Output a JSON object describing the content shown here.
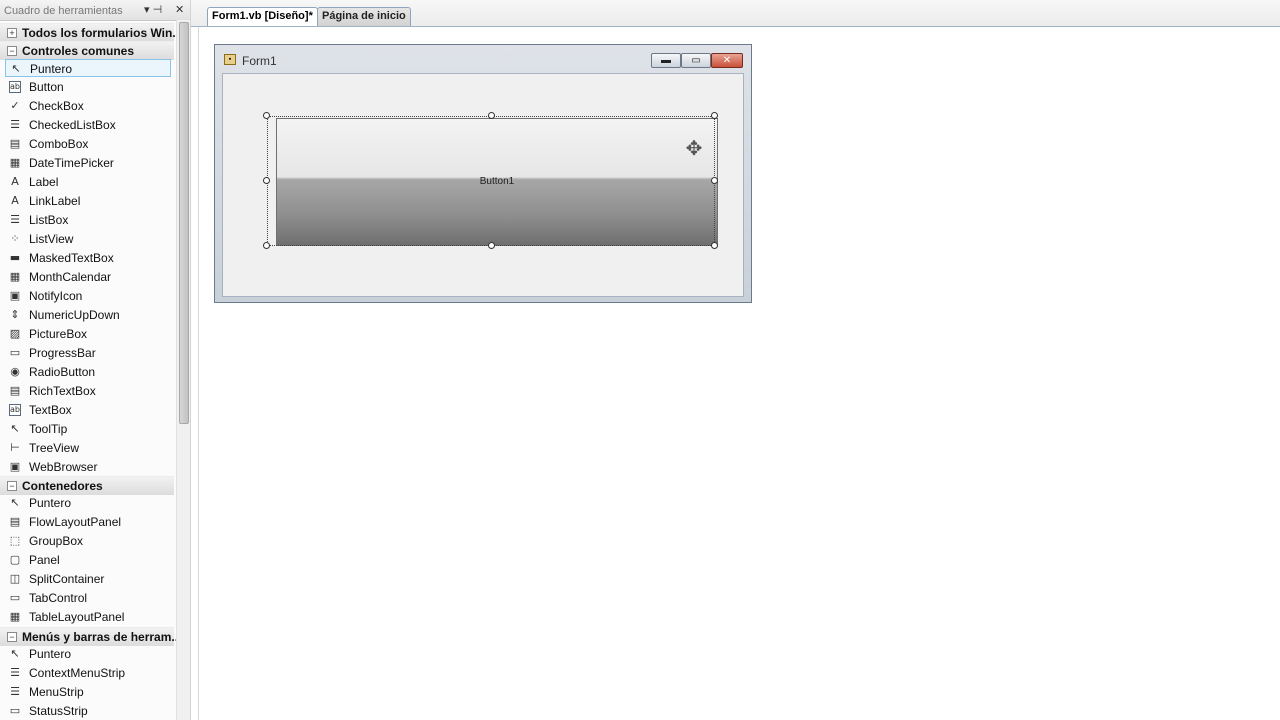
{
  "toolbox": {
    "title": "Cuadro de herramientas",
    "pin_icon": "▾ ⊣",
    "close_icon": "✕",
    "groups": {
      "all": {
        "expander": "+",
        "label": "Todos los formularios Win..."
      },
      "common": {
        "expander": "−",
        "label": "Controles comunes"
      },
      "containers": {
        "expander": "−",
        "label": "Contenedores"
      },
      "menus": {
        "expander": "−",
        "label": "Menús y barras de herram..."
      }
    },
    "common_items": [
      {
        "label": "Puntero",
        "icon": "pointer-icon",
        "glyph": "↖"
      },
      {
        "label": "Button",
        "icon": "button-icon",
        "glyph": "ab"
      },
      {
        "label": "CheckBox",
        "icon": "checkbox-icon",
        "glyph": "✓"
      },
      {
        "label": "CheckedListBox",
        "icon": "checkedlistbox-icon",
        "glyph": "☰"
      },
      {
        "label": "ComboBox",
        "icon": "combobox-icon",
        "glyph": "▤"
      },
      {
        "label": "DateTimePicker",
        "icon": "datetimepicker-icon",
        "glyph": "▦"
      },
      {
        "label": "Label",
        "icon": "label-icon",
        "glyph": "A"
      },
      {
        "label": "LinkLabel",
        "icon": "linklabel-icon",
        "glyph": "A"
      },
      {
        "label": "ListBox",
        "icon": "listbox-icon",
        "glyph": "☰"
      },
      {
        "label": "ListView",
        "icon": "listview-icon",
        "glyph": "⁘"
      },
      {
        "label": "MaskedTextBox",
        "icon": "maskedtextbox-icon",
        "glyph": "▬"
      },
      {
        "label": "MonthCalendar",
        "icon": "monthcalendar-icon",
        "glyph": "▦"
      },
      {
        "label": "NotifyIcon",
        "icon": "notifyicon-icon",
        "glyph": "▣"
      },
      {
        "label": "NumericUpDown",
        "icon": "numericupdown-icon",
        "glyph": "⇕"
      },
      {
        "label": "PictureBox",
        "icon": "picturebox-icon",
        "glyph": "▨"
      },
      {
        "label": "ProgressBar",
        "icon": "progressbar-icon",
        "glyph": "▭"
      },
      {
        "label": "RadioButton",
        "icon": "radiobutton-icon",
        "glyph": "◉"
      },
      {
        "label": "RichTextBox",
        "icon": "richtextbox-icon",
        "glyph": "▤"
      },
      {
        "label": "TextBox",
        "icon": "textbox-icon",
        "glyph": "ab"
      },
      {
        "label": "ToolTip",
        "icon": "tooltip-icon",
        "glyph": "↖"
      },
      {
        "label": "TreeView",
        "icon": "treeview-icon",
        "glyph": "⊢"
      },
      {
        "label": "WebBrowser",
        "icon": "webbrowser-icon",
        "glyph": "▣"
      }
    ],
    "container_items": [
      {
        "label": "Puntero",
        "icon": "pointer-icon",
        "glyph": "↖"
      },
      {
        "label": "FlowLayoutPanel",
        "icon": "flowlayoutpanel-icon",
        "glyph": "▤"
      },
      {
        "label": "GroupBox",
        "icon": "groupbox-icon",
        "glyph": "⬚"
      },
      {
        "label": "Panel",
        "icon": "panel-icon",
        "glyph": "▢"
      },
      {
        "label": "SplitContainer",
        "icon": "splitcontainer-icon",
        "glyph": "◫"
      },
      {
        "label": "TabControl",
        "icon": "tabcontrol-icon",
        "glyph": "▭"
      },
      {
        "label": "TableLayoutPanel",
        "icon": "tablelayoutpanel-icon",
        "glyph": "▦"
      }
    ],
    "menu_items": [
      {
        "label": "Puntero",
        "icon": "pointer-icon",
        "glyph": "↖"
      },
      {
        "label": "ContextMenuStrip",
        "icon": "contextmenustrip-icon",
        "glyph": "☰"
      },
      {
        "label": "MenuStrip",
        "icon": "menustrip-icon",
        "glyph": "☰"
      },
      {
        "label": "StatusStrip",
        "icon": "statusstrip-icon",
        "glyph": "▭"
      }
    ]
  },
  "tabs": {
    "design": "Form1.vb [Diseño]*",
    "start": "Página de inicio"
  },
  "form": {
    "title": "Form1",
    "min_glyph": "▬",
    "max_glyph": "▭",
    "close_glyph": "✕",
    "button_text": "Button1",
    "move_glyph": "✥"
  },
  "colors": {
    "selected_item_bg": "#eaf5fc",
    "selected_item_border": "#8ac4ea",
    "close_button": "#c9503a"
  }
}
